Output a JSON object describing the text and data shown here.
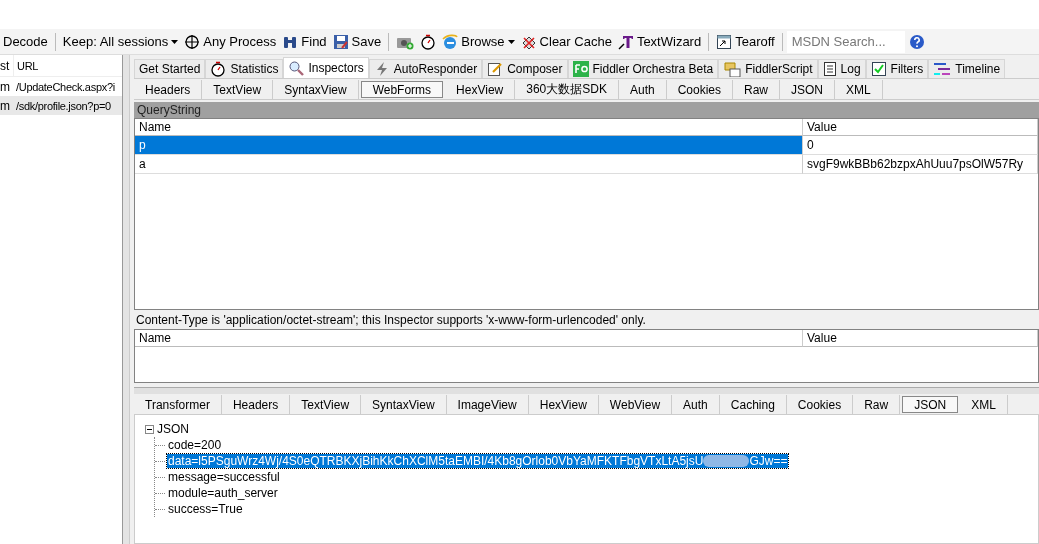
{
  "toolbar": [
    {
      "kind": "button",
      "label": "Decode",
      "dropdown": false
    },
    {
      "kind": "separator"
    },
    {
      "kind": "button",
      "label": "Keep: All sessions",
      "dropdown": true
    },
    {
      "kind": "button",
      "label": "Any Process",
      "dropdown": false
    },
    {
      "kind": "button",
      "label": "Find",
      "dropdown": false
    },
    {
      "kind": "button",
      "label": "Save",
      "dropdown": false
    },
    {
      "kind": "separator"
    },
    {
      "kind": "icon_button",
      "dropdown": false
    },
    {
      "kind": "icon_button",
      "dropdown": false
    },
    {
      "kind": "button",
      "label": "Browse",
      "dropdown": true
    },
    {
      "kind": "button",
      "label": "Clear Cache",
      "dropdown": false
    },
    {
      "kind": "button",
      "label": "TextWizard",
      "dropdown": false
    },
    {
      "kind": "separator"
    },
    {
      "kind": "button",
      "label": "Tearoff",
      "dropdown": false
    },
    {
      "kind": "separator"
    },
    {
      "kind": "search",
      "placeholder": "MSDN Search..."
    },
    {
      "kind": "help"
    }
  ],
  "sessions": {
    "columns": [
      "st",
      "URL"
    ],
    "rows": [
      {
        "cells": [
          "m",
          "/UpdateCheck.aspx?i"
        ],
        "selected": false
      },
      {
        "cells": [
          "m",
          "/sdk/profile.json?p=0"
        ],
        "selected": true
      }
    ]
  },
  "main_tabs": [
    {
      "label": "Get Started",
      "selected": false
    },
    {
      "label": "Statistics",
      "selected": false
    },
    {
      "label": "Inspectors",
      "selected": true
    },
    {
      "label": "AutoResponder",
      "selected": false
    },
    {
      "label": "Composer",
      "selected": false
    },
    {
      "label": "Fiddler Orchestra Beta",
      "selected": false
    },
    {
      "label": "FiddlerScript",
      "selected": false
    },
    {
      "label": "Log",
      "selected": false
    },
    {
      "label": "Filters",
      "selected": false
    },
    {
      "label": "Timeline",
      "selected": false
    }
  ],
  "request_tabs": [
    {
      "label": "Headers",
      "selected": false
    },
    {
      "label": "TextView",
      "selected": false
    },
    {
      "label": "SyntaxView",
      "selected": false
    },
    {
      "label": "WebForms",
      "selected": true
    },
    {
      "label": "HexView",
      "selected": false
    },
    {
      "label": "360大数据SDK",
      "selected": false
    },
    {
      "label": "Auth",
      "selected": false
    },
    {
      "label": "Cookies",
      "selected": false
    },
    {
      "label": "Raw",
      "selected": false
    },
    {
      "label": "JSON",
      "selected": false
    },
    {
      "label": "XML",
      "selected": false
    }
  ],
  "query_string": {
    "title": "QueryString",
    "columns": [
      "Name",
      "Value"
    ],
    "rows": [
      {
        "name": "p",
        "value": "0",
        "selected": true
      },
      {
        "name": "a",
        "value": "svgF9wkBBb62bzpxAhUuu7psOlW57Ry",
        "selected": false
      }
    ]
  },
  "body_note": "Content-Type is 'application/octet-stream'; this Inspector supports 'x-www-form-urlencoded' only.",
  "body_table": {
    "columns": [
      "Name",
      "Value"
    ]
  },
  "response_tabs": [
    {
      "label": "Transformer",
      "selected": false
    },
    {
      "label": "Headers",
      "selected": false
    },
    {
      "label": "TextView",
      "selected": false
    },
    {
      "label": "SyntaxView",
      "selected": false
    },
    {
      "label": "ImageView",
      "selected": false
    },
    {
      "label": "HexView",
      "selected": false
    },
    {
      "label": "WebView",
      "selected": false
    },
    {
      "label": "Auth",
      "selected": false
    },
    {
      "label": "Caching",
      "selected": false
    },
    {
      "label": "Cookies",
      "selected": false
    },
    {
      "label": "Raw",
      "selected": false
    },
    {
      "label": "JSON",
      "selected": true
    },
    {
      "label": "XML",
      "selected": false
    }
  ],
  "json_tree": {
    "label": "JSON",
    "expanded": true,
    "children": [
      {
        "label": "code=200",
        "selected": false
      },
      {
        "label": "data=l5PSguWrz4Wj/4S0eQTRBKXjBihKkChXClM5taEMBI/4Kb8gOrlob0VbYaMFKTFbgVTxLtA5jsU",
        "label_end": "GJw==",
        "selected": true
      },
      {
        "label": "message=successful",
        "selected": false
      },
      {
        "label": "module=auth_server",
        "selected": false
      },
      {
        "label": "success=True",
        "selected": false
      }
    ]
  }
}
